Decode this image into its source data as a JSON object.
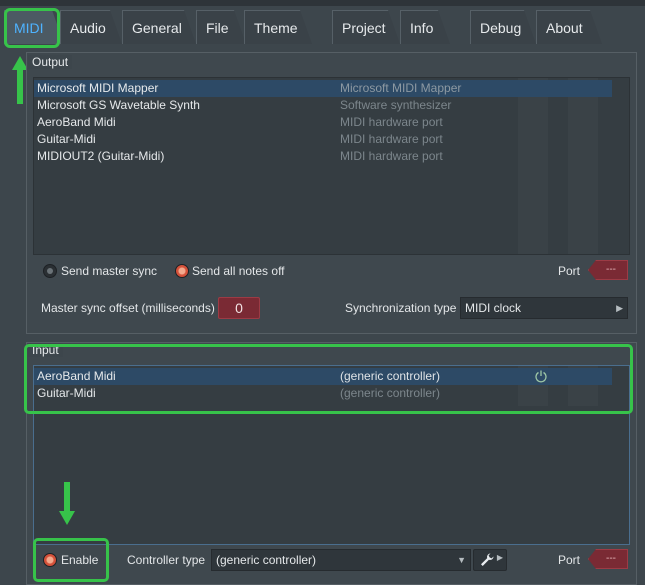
{
  "colors": {
    "accent_green": "#37c34a",
    "tab_active_text": "#4eb3ff",
    "port_red": "#7a2a34"
  },
  "tabs": [
    {
      "label": "MIDI",
      "active": true
    },
    {
      "label": "Audio"
    },
    {
      "label": "General"
    },
    {
      "label": "File"
    },
    {
      "label": "Theme"
    },
    {
      "label": "Project"
    },
    {
      "label": "Info"
    },
    {
      "label": "Debug"
    },
    {
      "label": "About"
    }
  ],
  "output": {
    "label": "Output",
    "devices": [
      {
        "name": "Microsoft MIDI Mapper",
        "desc": "Microsoft MIDI Mapper",
        "selected": true
      },
      {
        "name": "Microsoft GS Wavetable Synth",
        "desc": "Software synthesizer"
      },
      {
        "name": "AeroBand Midi",
        "desc": "MIDI hardware port"
      },
      {
        "name": "Guitar-Midi",
        "desc": "MIDI hardware port"
      },
      {
        "name": "MIDIOUT2 (Guitar-Midi)",
        "desc": "MIDI hardware port"
      }
    ],
    "send_master_sync": "Send master sync",
    "send_all_notes_off": "Send all notes off",
    "port_label": "Port",
    "port_value": "---",
    "master_sync_offset_label": "Master sync offset (milliseconds)",
    "master_sync_offset_value": "0",
    "sync_type_label": "Synchronization type",
    "sync_type_value": "MIDI clock"
  },
  "input": {
    "label": "Input",
    "devices": [
      {
        "name": "AeroBand Midi",
        "desc": "(generic controller)",
        "selected": true,
        "power_icon": "power-icon"
      },
      {
        "name": "Guitar-Midi",
        "desc": "(generic controller)"
      }
    ],
    "enable_label": "Enable",
    "controller_type_label": "Controller type",
    "controller_type_value": "(generic controller)",
    "port_label": "Port",
    "port_value": "---"
  },
  "icons": {
    "power": "power-icon",
    "wrench": "wrench-icon",
    "dropdown": "chevron-down-icon",
    "submenu": "chevron-right-icon"
  }
}
